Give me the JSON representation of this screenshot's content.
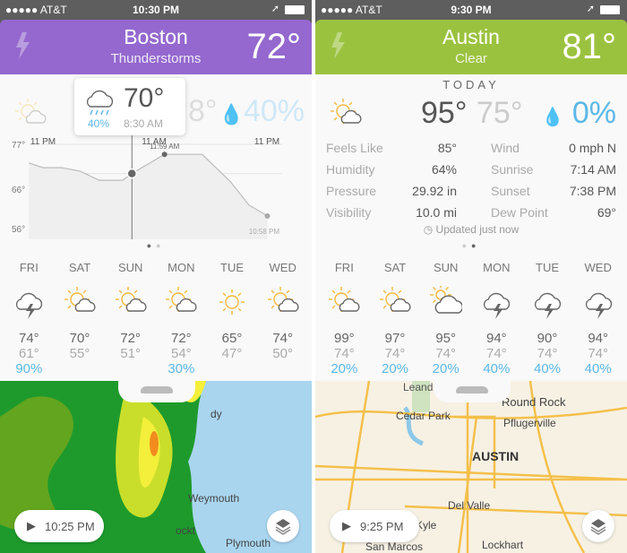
{
  "colors": {
    "boston": "#9468cf",
    "austin": "#9bc23f",
    "precip": "#5bb8e8",
    "sun": "#f5b93a"
  },
  "boston": {
    "status": {
      "carrier": "●●●●● AT&T",
      "time": "10:30 PM"
    },
    "header": {
      "city": "Boston",
      "condition": "Thunderstorms",
      "temp": "72°",
      "icon": "lightning-icon"
    },
    "today": {
      "icon": "partly-sunny-icon",
      "temp_partial": "8°",
      "precip": "40%"
    },
    "tooltip": {
      "icon": "rain-cloud-icon",
      "temp": "70°",
      "precip": "40%",
      "time": "8:30 AM"
    },
    "chart": {
      "x_labels": [
        "11 PM",
        "11 AM",
        "11 PM"
      ],
      "y_labels": [
        "77°",
        "66°",
        "56°"
      ],
      "high_label": "11:59 AM",
      "end_label": "10:58 PM",
      "points": [
        {
          "time": "9:30 PM",
          "temp": 72.7
        },
        {
          "time": "11:00 PM",
          "temp": 71.5
        },
        {
          "time": "1:00 AM",
          "temp": 71.5
        },
        {
          "time": "3:00 AM",
          "temp": 70.6
        },
        {
          "time": "5:00 AM",
          "temp": 68.3
        },
        {
          "time": "7:30 AM",
          "temp": 68.3
        },
        {
          "time": "8:30 AM",
          "temp": 70
        },
        {
          "time": "11:59 AM",
          "temp": 74.9
        },
        {
          "time": "4:00 PM",
          "temp": 74.9
        },
        {
          "time": "7:00 PM",
          "temp": 68
        },
        {
          "time": "9:00 PM",
          "temp": 62
        },
        {
          "time": "10:58 PM",
          "temp": 59.2
        }
      ]
    },
    "forecast": [
      {
        "day": "FRI",
        "icon": "thunderstorm-icon",
        "hi": "74°",
        "lo": "61°",
        "precip": "90%"
      },
      {
        "day": "SAT",
        "icon": "partly-sunny-icon",
        "hi": "70°",
        "lo": "55°",
        "precip": ""
      },
      {
        "day": "SUN",
        "icon": "partly-sunny-icon",
        "hi": "72°",
        "lo": "51°",
        "precip": ""
      },
      {
        "day": "MON",
        "icon": "partly-sunny-icon",
        "hi": "72°",
        "lo": "54°",
        "precip": "30%"
      },
      {
        "day": "TUE",
        "icon": "sunny-icon",
        "hi": "65°",
        "lo": "47°",
        "precip": ""
      },
      {
        "day": "WED",
        "icon": "partly-sunny-icon",
        "hi": "74°",
        "lo": "50°",
        "precip": ""
      }
    ],
    "map": {
      "time": "10:25 PM",
      "labels": [
        "dy",
        "Weymouth",
        "ockt",
        "Plymouth"
      ]
    }
  },
  "austin": {
    "status": {
      "carrier": "●●●●● AT&T",
      "time": "9:30 PM"
    },
    "header": {
      "city": "Austin",
      "condition": "Clear",
      "temp": "81°",
      "icon": "lightning-icon"
    },
    "today": {
      "label": "TODAY",
      "icon": "partly-sunny-icon",
      "hi": "95°",
      "lo": "75°",
      "precip": "0%",
      "updated": "Updated just now",
      "details": [
        {
          "label": "Feels Like",
          "value": "85°"
        },
        {
          "label": "Wind",
          "value": "0 mph N"
        },
        {
          "label": "Humidity",
          "value": "64%"
        },
        {
          "label": "Sunrise",
          "value": "7:14 AM"
        },
        {
          "label": "Pressure",
          "value": "29.92 in"
        },
        {
          "label": "Sunset",
          "value": "7:38 PM"
        },
        {
          "label": "Visibility",
          "value": "10.0 mi"
        },
        {
          "label": "Dew Point",
          "value": "69°"
        }
      ]
    },
    "forecast": [
      {
        "day": "FRI",
        "icon": "partly-sunny-icon",
        "hi": "99°",
        "lo": "74°",
        "precip": "20%"
      },
      {
        "day": "SAT",
        "icon": "partly-sunny-icon",
        "hi": "97°",
        "lo": "74°",
        "precip": "20%"
      },
      {
        "day": "SUN",
        "icon": "mostly-cloudy-icon",
        "hi": "95°",
        "lo": "74°",
        "precip": "20%"
      },
      {
        "day": "MON",
        "icon": "thunderstorm-icon",
        "hi": "94°",
        "lo": "74°",
        "precip": "40%"
      },
      {
        "day": "TUE",
        "icon": "thunderstorm-icon",
        "hi": "90°",
        "lo": "74°",
        "precip": "40%"
      },
      {
        "day": "WED",
        "icon": "thunderstorm-icon",
        "hi": "94°",
        "lo": "74°",
        "precip": "40%"
      }
    ],
    "map": {
      "time": "9:25 PM",
      "labels": [
        "Leand",
        "Round Rock",
        "Cedar Park",
        "Pflugerville",
        "AUSTIN",
        "Del Valle",
        "Kyle",
        "San Marcos",
        "Lockhart"
      ]
    }
  }
}
